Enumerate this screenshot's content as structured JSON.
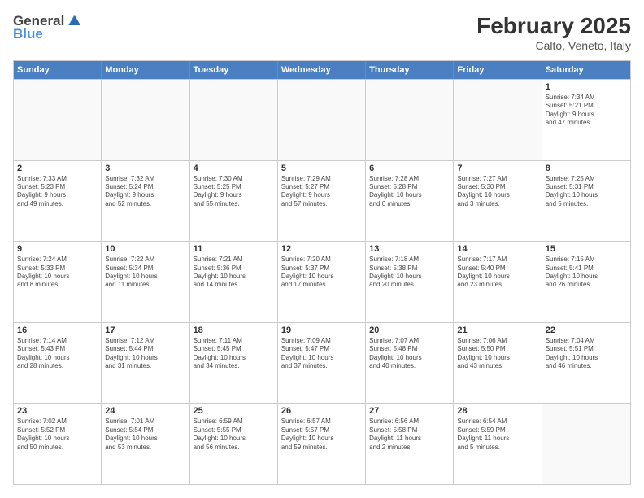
{
  "header": {
    "logo": {
      "general": "General",
      "blue": "Blue"
    },
    "title": "February 2025",
    "subtitle": "Calto, Veneto, Italy"
  },
  "weekdays": [
    "Sunday",
    "Monday",
    "Tuesday",
    "Wednesday",
    "Thursday",
    "Friday",
    "Saturday"
  ],
  "rows": [
    {
      "cells": [
        {
          "empty": true
        },
        {
          "empty": true
        },
        {
          "empty": true
        },
        {
          "empty": true
        },
        {
          "empty": true
        },
        {
          "empty": true
        },
        {
          "day": 1,
          "info": "Sunrise: 7:34 AM\nSunset: 5:21 PM\nDaylight: 9 hours\nand 47 minutes."
        }
      ]
    },
    {
      "cells": [
        {
          "day": 2,
          "info": "Sunrise: 7:33 AM\nSunset: 5:23 PM\nDaylight: 9 hours\nand 49 minutes."
        },
        {
          "day": 3,
          "info": "Sunrise: 7:32 AM\nSunset: 5:24 PM\nDaylight: 9 hours\nand 52 minutes."
        },
        {
          "day": 4,
          "info": "Sunrise: 7:30 AM\nSunset: 5:25 PM\nDaylight: 9 hours\nand 55 minutes."
        },
        {
          "day": 5,
          "info": "Sunrise: 7:29 AM\nSunset: 5:27 PM\nDaylight: 9 hours\nand 57 minutes."
        },
        {
          "day": 6,
          "info": "Sunrise: 7:28 AM\nSunset: 5:28 PM\nDaylight: 10 hours\nand 0 minutes."
        },
        {
          "day": 7,
          "info": "Sunrise: 7:27 AM\nSunset: 5:30 PM\nDaylight: 10 hours\nand 3 minutes."
        },
        {
          "day": 8,
          "info": "Sunrise: 7:25 AM\nSunset: 5:31 PM\nDaylight: 10 hours\nand 5 minutes."
        }
      ]
    },
    {
      "cells": [
        {
          "day": 9,
          "info": "Sunrise: 7:24 AM\nSunset: 5:33 PM\nDaylight: 10 hours\nand 8 minutes."
        },
        {
          "day": 10,
          "info": "Sunrise: 7:22 AM\nSunset: 5:34 PM\nDaylight: 10 hours\nand 11 minutes."
        },
        {
          "day": 11,
          "info": "Sunrise: 7:21 AM\nSunset: 5:36 PM\nDaylight: 10 hours\nand 14 minutes."
        },
        {
          "day": 12,
          "info": "Sunrise: 7:20 AM\nSunset: 5:37 PM\nDaylight: 10 hours\nand 17 minutes."
        },
        {
          "day": 13,
          "info": "Sunrise: 7:18 AM\nSunset: 5:38 PM\nDaylight: 10 hours\nand 20 minutes."
        },
        {
          "day": 14,
          "info": "Sunrise: 7:17 AM\nSunset: 5:40 PM\nDaylight: 10 hours\nand 23 minutes."
        },
        {
          "day": 15,
          "info": "Sunrise: 7:15 AM\nSunset: 5:41 PM\nDaylight: 10 hours\nand 26 minutes."
        }
      ]
    },
    {
      "cells": [
        {
          "day": 16,
          "info": "Sunrise: 7:14 AM\nSunset: 5:43 PM\nDaylight: 10 hours\nand 28 minutes."
        },
        {
          "day": 17,
          "info": "Sunrise: 7:12 AM\nSunset: 5:44 PM\nDaylight: 10 hours\nand 31 minutes."
        },
        {
          "day": 18,
          "info": "Sunrise: 7:11 AM\nSunset: 5:45 PM\nDaylight: 10 hours\nand 34 minutes."
        },
        {
          "day": 19,
          "info": "Sunrise: 7:09 AM\nSunset: 5:47 PM\nDaylight: 10 hours\nand 37 minutes."
        },
        {
          "day": 20,
          "info": "Sunrise: 7:07 AM\nSunset: 5:48 PM\nDaylight: 10 hours\nand 40 minutes."
        },
        {
          "day": 21,
          "info": "Sunrise: 7:06 AM\nSunset: 5:50 PM\nDaylight: 10 hours\nand 43 minutes."
        },
        {
          "day": 22,
          "info": "Sunrise: 7:04 AM\nSunset: 5:51 PM\nDaylight: 10 hours\nand 46 minutes."
        }
      ]
    },
    {
      "cells": [
        {
          "day": 23,
          "info": "Sunrise: 7:02 AM\nSunset: 5:52 PM\nDaylight: 10 hours\nand 50 minutes."
        },
        {
          "day": 24,
          "info": "Sunrise: 7:01 AM\nSunset: 5:54 PM\nDaylight: 10 hours\nand 53 minutes."
        },
        {
          "day": 25,
          "info": "Sunrise: 6:59 AM\nSunset: 5:55 PM\nDaylight: 10 hours\nand 56 minutes."
        },
        {
          "day": 26,
          "info": "Sunrise: 6:57 AM\nSunset: 5:57 PM\nDaylight: 10 hours\nand 59 minutes."
        },
        {
          "day": 27,
          "info": "Sunrise: 6:56 AM\nSunset: 5:58 PM\nDaylight: 11 hours\nand 2 minutes."
        },
        {
          "day": 28,
          "info": "Sunrise: 6:54 AM\nSunset: 5:59 PM\nDaylight: 11 hours\nand 5 minutes."
        },
        {
          "empty": true
        }
      ]
    }
  ]
}
